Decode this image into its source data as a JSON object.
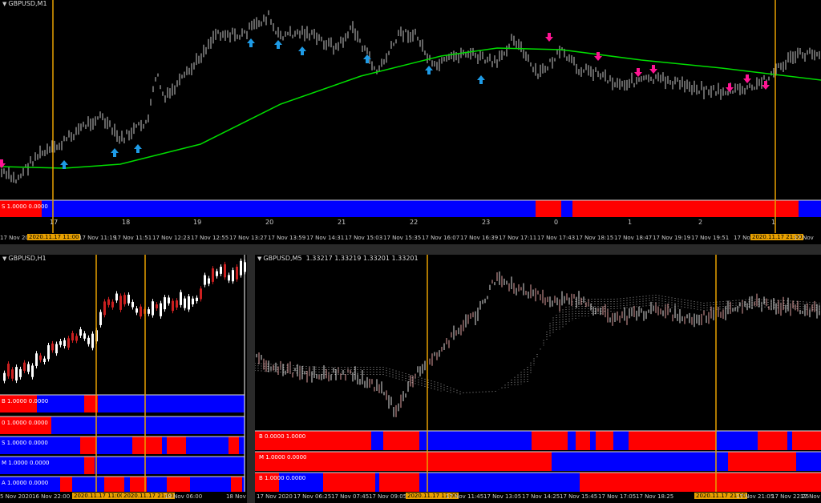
{
  "colors": {
    "bg": "#000000",
    "bull": "#ffffff",
    "bear": "#cc2020",
    "ma": "#00dd00",
    "buy": "#1e9be6",
    "sell": "#ff1493",
    "red": "#ff0000",
    "blue": "#0000ff",
    "vline": "#e8a000"
  },
  "top": {
    "title": "GBPUSD,M1",
    "indicator_label": "S 1.0000 0.0000",
    "day_labels": [
      "17",
      "18",
      "19",
      "20",
      "21",
      "22",
      "23",
      "0",
      "1",
      "2",
      "1"
    ],
    "time_labels": [
      "17 Nov 2020",
      "2020.11.17 11:00",
      "17 Nov 11:19",
      "17 Nov 11:51",
      "17 Nov 12:23",
      "17 Nov 12:55",
      "17 Nov 13:27",
      "17 Nov 13:59",
      "17 Nov 14:31",
      "17 Nov 15:03",
      "17 Nov 15:35",
      "17 Nov 16:07",
      "17 Nov 16:39",
      "17 Nov 17:11",
      "17 Nov 17:43",
      "17 Nov 18:15",
      "17 Nov 18:47",
      "17 Nov 19:19",
      "17 Nov 19:51",
      "17 Nov",
      "2020.11.17 21:00",
      "17 Nov"
    ]
  },
  "left": {
    "title": "GBPUSD,H1",
    "indicator_labels": [
      "B 1.0000 0.0000",
      "0 1.0000 0.0000",
      "S 1.0000 0.0000",
      "M 1.0000 0.0000",
      "A 1.0000 0.0000"
    ],
    "time_labels": [
      "5 Nov 2020",
      "16 Nov 22:00",
      "2020.11.17 11:00",
      "2020.11.17 21:00",
      "18 Nov 06:00",
      "18 Nov"
    ]
  },
  "right": {
    "title": "GBPUSD,M5",
    "quote": "1.33217 1.33219 1.33201 1.33201",
    "indicator_labels": [
      "B 0.0000 1.0000",
      "M 1.0000 0.0000",
      "B 1.0000 0.0000"
    ],
    "time_labels": [
      "17 Nov 2020",
      "17 Nov 06:25",
      "17 Nov 07:45",
      "17 Nov 09:05",
      "2020.11.17 11:00",
      "17 Nov 11:45",
      "17 Nov 13:05",
      "17 Nov 14:25",
      "17 Nov 15:45",
      "17 Nov 17:05",
      "17 Nov 18:25",
      "2020.11.17 21:00",
      "17 Nov 21:05",
      "17 Nov 22:25",
      "17 Nov 23"
    ]
  }
}
